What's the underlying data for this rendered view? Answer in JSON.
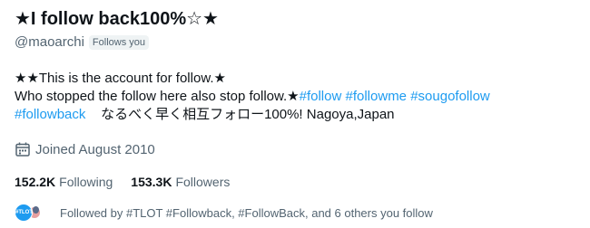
{
  "profile": {
    "display_name": "★I follow back100%☆★",
    "handle": "@maoarchi",
    "follows_you_badge": "Follows you"
  },
  "bio": {
    "line1": "★★This is the account for follow.★",
    "line2_text": "Who stopped the follow here also stop follow.★",
    "hashtags_line2": [
      "#follow",
      "#followme",
      "#sougofollow"
    ],
    "hashtag_line3": "#followback",
    "line3_text": "なるべく早く相互フォロー100%!  Nagoya,Japan"
  },
  "joined": {
    "icon": "calendar-icon",
    "text": "Joined August 2010"
  },
  "stats": {
    "following_count": "152.2K",
    "following_label": "Following",
    "followers_count": "153.3K",
    "followers_label": "Followers"
  },
  "followed_by": {
    "avatar1_text": "#TLOT",
    "text": "Followed by #TLOT #Followback, #FollowBack, and 6 others you follow"
  },
  "colors": {
    "text_primary": "#0f1419",
    "text_secondary": "#536471",
    "link": "#1d9bf0",
    "badge_bg": "#eff3f4"
  }
}
